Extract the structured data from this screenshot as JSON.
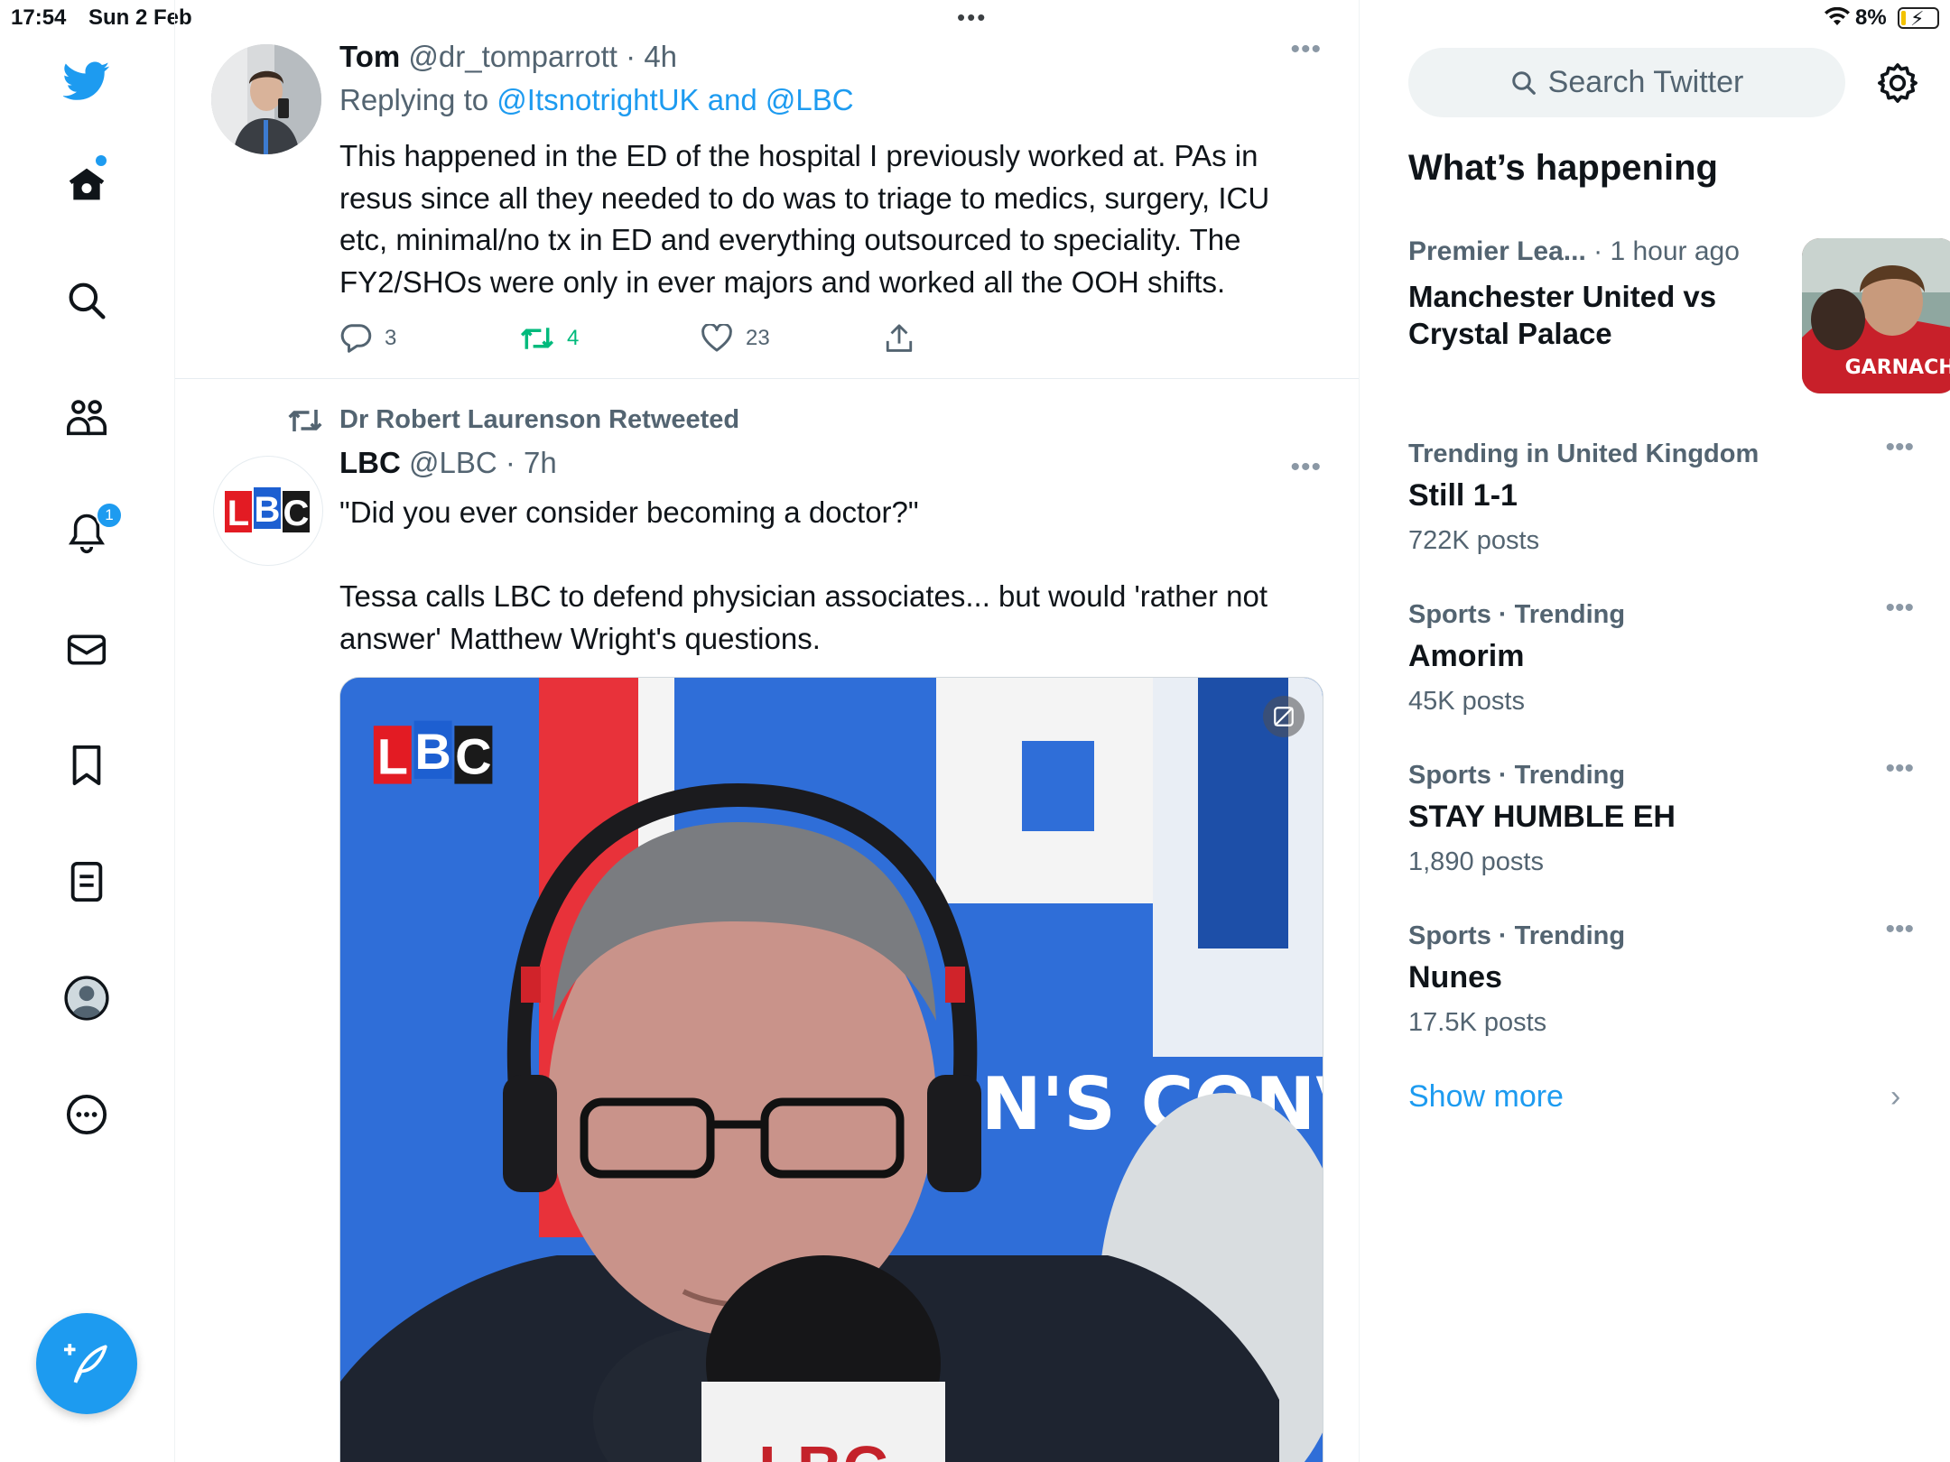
{
  "status_bar": {
    "time": "17:54",
    "date": "Sun 2 Feb",
    "battery": "8%"
  },
  "nav": {
    "notifications_badge": "1",
    "icons": [
      "twitter-logo-icon",
      "home-icon",
      "search-icon",
      "communities-icon",
      "notifications-icon",
      "messages-icon",
      "bookmarks-icon",
      "lists-icon",
      "profile-icon",
      "more-icon",
      "compose-icon"
    ]
  },
  "tweet1": {
    "name": "Tom",
    "handle": "@dr_tomparrott",
    "time": "4h",
    "replying_prefix": "Replying to",
    "replying_to": "@ItsnotrightUK and @LBC",
    "text": [
      "This happened in the ED of the hospital I previously worked at. PAs in",
      "resus since all they needed to do was to triage to medics, surgery, ICU",
      "etc, minimal/no tx in ED and everything outsourced to speciality. The",
      "FY2/SHOs were only in ever majors and worked all the OOH shifts."
    ],
    "replies": "3",
    "retweets": "4",
    "likes": "23"
  },
  "tweet2": {
    "retweeted_by": "Dr Robert Laurenson Retweeted",
    "name": "LBC",
    "handle": "@LBC",
    "time": "7h",
    "avatar_text": "LBC",
    "text_line1": "\"Did you ever consider becoming a doctor?\"",
    "text_line2": "Tessa calls LBC to defend physician associates... but would 'rather not",
    "text_line3": "answer' Matthew Wright's questions.",
    "media_logo": "LBC",
    "media_backdrop_text": "IN'S CONVERS",
    "media_mic_text": "LBC"
  },
  "sidebar": {
    "search_placeholder": "Search Twitter",
    "section_title": "What’s happening",
    "news": {
      "source": "Premier Lea...",
      "time": "· 1 hour ago",
      "headline": "Manchester United vs Crystal Palace",
      "thumb_text": "GARNACHO"
    },
    "trends": [
      {
        "context": "Trending in United Kingdom",
        "topic": "Still 1-1",
        "count": "722K posts"
      },
      {
        "context": "Sports · Trending",
        "topic": "Amorim",
        "count": "45K posts"
      },
      {
        "context": "Sports · Trending",
        "topic": "STAY HUMBLE EH",
        "count": "1,890 posts"
      },
      {
        "context": "Sports · Trending",
        "topic": "Nunes",
        "count": "17.5K posts"
      }
    ],
    "show_more": "Show more"
  },
  "colors": {
    "accent": "#1d9bf0",
    "retweet_green": "#00ba7c",
    "secondary_text": "#536471"
  }
}
